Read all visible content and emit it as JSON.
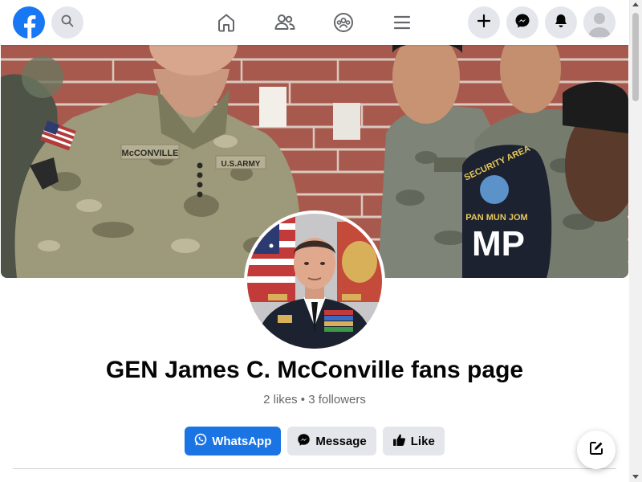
{
  "colors": {
    "brand": "#1877f2",
    "primary_button": "#1b74e4",
    "secondary_button": "#e4e6eb",
    "text_primary": "#050505",
    "text_secondary": "#65676b",
    "icon_gray": "#65676b"
  },
  "topbar": {
    "logo_icon": "facebook-logo-icon",
    "search_icon": "search-icon",
    "nav": [
      {
        "icon": "home-icon"
      },
      {
        "icon": "friends-icon"
      },
      {
        "icon": "groups-icon"
      },
      {
        "icon": "menu-icon"
      }
    ],
    "right": [
      {
        "icon": "plus-icon"
      },
      {
        "icon": "messenger-icon"
      },
      {
        "icon": "bell-icon"
      },
      {
        "icon": "profile-avatar-icon"
      }
    ]
  },
  "cover": {
    "nametape": "McCONVILLE",
    "branch_tape": "U.S.ARMY",
    "armband_top": "SECURITY AREA",
    "armband_mid": "PAN MUN JOM",
    "armband_mp": "MP"
  },
  "page": {
    "title": "GEN James C. McConville fans page",
    "stats": "2 likes • 3 followers"
  },
  "actions": {
    "whatsapp_label": "WhatsApp",
    "message_label": "Message",
    "like_label": "Like"
  },
  "fab": {
    "icon": "compose-icon"
  }
}
